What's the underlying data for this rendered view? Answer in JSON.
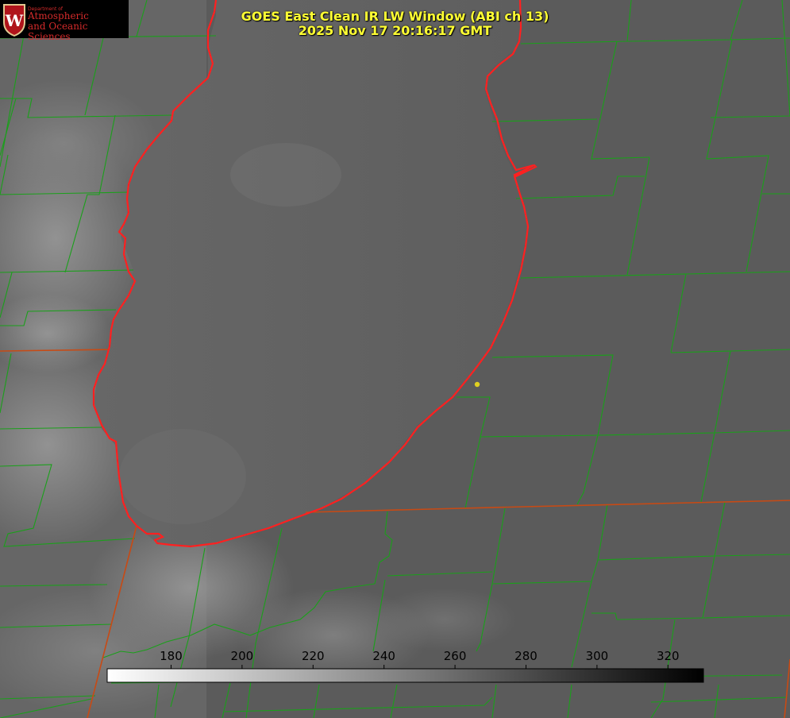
{
  "title": {
    "line1": "GOES East Clean IR LW Window (ABI ch 13)",
    "line2": "2025 Nov 17 20:16:17 GMT"
  },
  "logo": {
    "line1": "Department of",
    "line2": "Atmospheric",
    "line3": "and Oceanic Sciences",
    "crest_letter": "W"
  },
  "colorbar": {
    "ticks": [
      "180",
      "200",
      "220",
      "240",
      "260",
      "280",
      "300",
      "320"
    ],
    "tick_values": [
      180,
      200,
      220,
      240,
      260,
      280,
      300,
      320
    ],
    "min": 162,
    "max": 330,
    "gradient": "white-to-black"
  },
  "colors": {
    "coastline": "#ff2020",
    "county_lines": "#1aa01a",
    "state_lines": "#c84a14",
    "marker": "#e0d020",
    "title_text": "#ffff33"
  }
}
